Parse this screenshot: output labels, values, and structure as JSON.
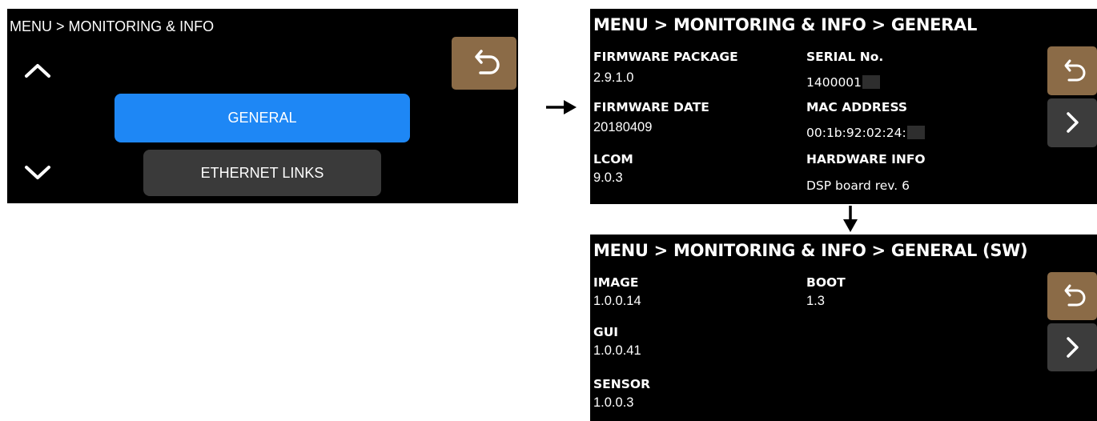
{
  "screen1": {
    "breadcrumb": "MENU > MONITORING & INFO",
    "items": [
      {
        "label": "GENERAL",
        "selected": true
      },
      {
        "label": "ETHERNET LINKS",
        "selected": false
      }
    ],
    "icons": {
      "up": "chevron-up-icon",
      "down": "chevron-down-icon",
      "back": "undo-arrow-icon"
    }
  },
  "screen2": {
    "breadcrumb": "MENU > MONITORING & INFO > GENERAL",
    "fields": {
      "firmware_package": {
        "label": "FIRMWARE PACKAGE",
        "value": "2.9.1.0"
      },
      "firmware_date": {
        "label": "FIRMWARE DATE",
        "value": "20180409"
      },
      "lcom": {
        "label": "LCOM",
        "value": "9.0.3"
      },
      "serial": {
        "label": "SERIAL No.",
        "value": "1400001"
      },
      "mac": {
        "label": "MAC ADDRESS",
        "value": "00:1b:92:02:24:"
      },
      "hardware": {
        "label": "HARDWARE INFO",
        "value": "DSP board rev. 6"
      }
    }
  },
  "screen3": {
    "breadcrumb": "MENU > MONITORING & INFO > GENERAL (SW)",
    "fields": {
      "image": {
        "label": "IMAGE",
        "value": "1.0.0.14"
      },
      "gui": {
        "label": "GUI",
        "value": "1.0.0.41"
      },
      "sensor": {
        "label": "SENSOR",
        "value": "1.0.0.3"
      },
      "boot": {
        "label": "BOOT",
        "value": "1.3"
      }
    }
  },
  "colors": {
    "selected": "#1e87f5",
    "back_button": "#8b6b47",
    "next_button": "#3c3c3c",
    "screen_bg": "#000000"
  }
}
